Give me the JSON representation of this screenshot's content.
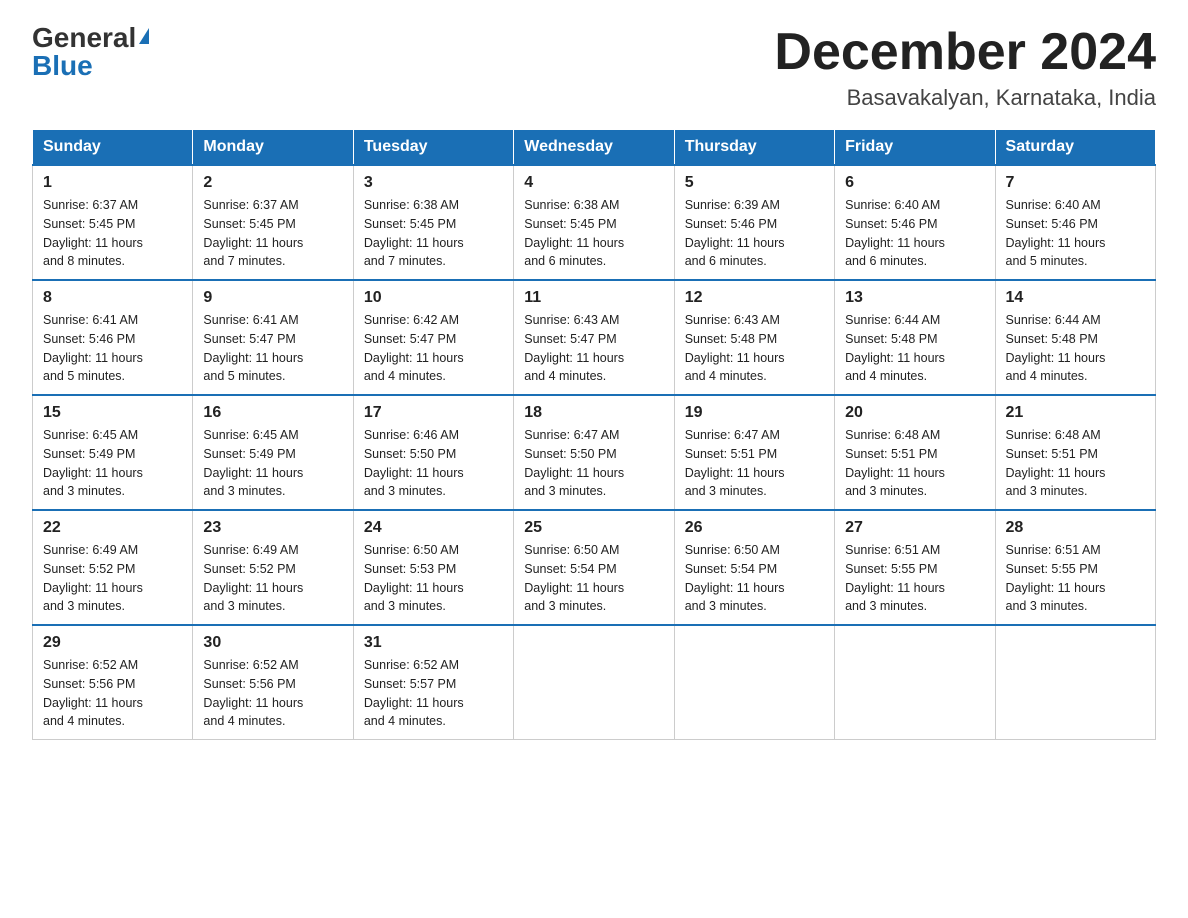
{
  "logo": {
    "general": "General",
    "blue": "Blue"
  },
  "header": {
    "month_year": "December 2024",
    "location": "Basavakalyan, Karnataka, India"
  },
  "days_of_week": [
    "Sunday",
    "Monday",
    "Tuesday",
    "Wednesday",
    "Thursday",
    "Friday",
    "Saturday"
  ],
  "weeks": [
    [
      {
        "day": "1",
        "sunrise": "6:37 AM",
        "sunset": "5:45 PM",
        "daylight": "11 hours and 8 minutes."
      },
      {
        "day": "2",
        "sunrise": "6:37 AM",
        "sunset": "5:45 PM",
        "daylight": "11 hours and 7 minutes."
      },
      {
        "day": "3",
        "sunrise": "6:38 AM",
        "sunset": "5:45 PM",
        "daylight": "11 hours and 7 minutes."
      },
      {
        "day": "4",
        "sunrise": "6:38 AM",
        "sunset": "5:45 PM",
        "daylight": "11 hours and 6 minutes."
      },
      {
        "day": "5",
        "sunrise": "6:39 AM",
        "sunset": "5:46 PM",
        "daylight": "11 hours and 6 minutes."
      },
      {
        "day": "6",
        "sunrise": "6:40 AM",
        "sunset": "5:46 PM",
        "daylight": "11 hours and 6 minutes."
      },
      {
        "day": "7",
        "sunrise": "6:40 AM",
        "sunset": "5:46 PM",
        "daylight": "11 hours and 5 minutes."
      }
    ],
    [
      {
        "day": "8",
        "sunrise": "6:41 AM",
        "sunset": "5:46 PM",
        "daylight": "11 hours and 5 minutes."
      },
      {
        "day": "9",
        "sunrise": "6:41 AM",
        "sunset": "5:47 PM",
        "daylight": "11 hours and 5 minutes."
      },
      {
        "day": "10",
        "sunrise": "6:42 AM",
        "sunset": "5:47 PM",
        "daylight": "11 hours and 4 minutes."
      },
      {
        "day": "11",
        "sunrise": "6:43 AM",
        "sunset": "5:47 PM",
        "daylight": "11 hours and 4 minutes."
      },
      {
        "day": "12",
        "sunrise": "6:43 AM",
        "sunset": "5:48 PM",
        "daylight": "11 hours and 4 minutes."
      },
      {
        "day": "13",
        "sunrise": "6:44 AM",
        "sunset": "5:48 PM",
        "daylight": "11 hours and 4 minutes."
      },
      {
        "day": "14",
        "sunrise": "6:44 AM",
        "sunset": "5:48 PM",
        "daylight": "11 hours and 4 minutes."
      }
    ],
    [
      {
        "day": "15",
        "sunrise": "6:45 AM",
        "sunset": "5:49 PM",
        "daylight": "11 hours and 3 minutes."
      },
      {
        "day": "16",
        "sunrise": "6:45 AM",
        "sunset": "5:49 PM",
        "daylight": "11 hours and 3 minutes."
      },
      {
        "day": "17",
        "sunrise": "6:46 AM",
        "sunset": "5:50 PM",
        "daylight": "11 hours and 3 minutes."
      },
      {
        "day": "18",
        "sunrise": "6:47 AM",
        "sunset": "5:50 PM",
        "daylight": "11 hours and 3 minutes."
      },
      {
        "day": "19",
        "sunrise": "6:47 AM",
        "sunset": "5:51 PM",
        "daylight": "11 hours and 3 minutes."
      },
      {
        "day": "20",
        "sunrise": "6:48 AM",
        "sunset": "5:51 PM",
        "daylight": "11 hours and 3 minutes."
      },
      {
        "day": "21",
        "sunrise": "6:48 AM",
        "sunset": "5:51 PM",
        "daylight": "11 hours and 3 minutes."
      }
    ],
    [
      {
        "day": "22",
        "sunrise": "6:49 AM",
        "sunset": "5:52 PM",
        "daylight": "11 hours and 3 minutes."
      },
      {
        "day": "23",
        "sunrise": "6:49 AM",
        "sunset": "5:52 PM",
        "daylight": "11 hours and 3 minutes."
      },
      {
        "day": "24",
        "sunrise": "6:50 AM",
        "sunset": "5:53 PM",
        "daylight": "11 hours and 3 minutes."
      },
      {
        "day": "25",
        "sunrise": "6:50 AM",
        "sunset": "5:54 PM",
        "daylight": "11 hours and 3 minutes."
      },
      {
        "day": "26",
        "sunrise": "6:50 AM",
        "sunset": "5:54 PM",
        "daylight": "11 hours and 3 minutes."
      },
      {
        "day": "27",
        "sunrise": "6:51 AM",
        "sunset": "5:55 PM",
        "daylight": "11 hours and 3 minutes."
      },
      {
        "day": "28",
        "sunrise": "6:51 AM",
        "sunset": "5:55 PM",
        "daylight": "11 hours and 3 minutes."
      }
    ],
    [
      {
        "day": "29",
        "sunrise": "6:52 AM",
        "sunset": "5:56 PM",
        "daylight": "11 hours and 4 minutes."
      },
      {
        "day": "30",
        "sunrise": "6:52 AM",
        "sunset": "5:56 PM",
        "daylight": "11 hours and 4 minutes."
      },
      {
        "day": "31",
        "sunrise": "6:52 AM",
        "sunset": "5:57 PM",
        "daylight": "11 hours and 4 minutes."
      },
      null,
      null,
      null,
      null
    ]
  ],
  "labels": {
    "sunrise": "Sunrise:",
    "sunset": "Sunset:",
    "daylight": "Daylight:"
  }
}
